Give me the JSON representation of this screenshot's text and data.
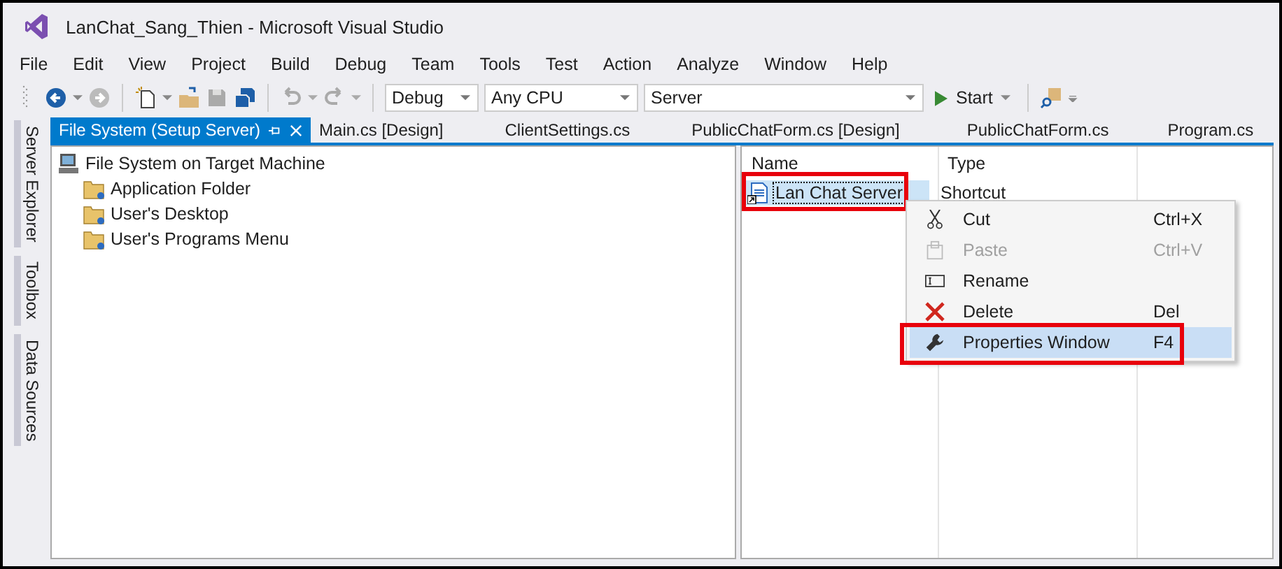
{
  "window": {
    "title": "LanChat_Sang_Thien - Microsoft Visual Studio"
  },
  "menu": [
    "File",
    "Edit",
    "View",
    "Project",
    "Build",
    "Debug",
    "Team",
    "Tools",
    "Test",
    "Action",
    "Analyze",
    "Window",
    "Help"
  ],
  "toolbar": {
    "configuration": "Debug",
    "platform": "Any CPU",
    "project": "Server",
    "start": "Start"
  },
  "side_tabs": [
    "Server Explorer",
    "Toolbox",
    "Data Sources"
  ],
  "tabs": [
    {
      "label": "File System (Setup Server)",
      "selected": true
    },
    {
      "label": "Main.cs [Design]",
      "selected": false
    },
    {
      "label": "ClientSettings.cs",
      "selected": false
    },
    {
      "label": "PublicChatForm.cs [Design]",
      "selected": false
    },
    {
      "label": "PublicChatForm.cs",
      "selected": false
    },
    {
      "label": "Program.cs",
      "selected": false
    }
  ],
  "tree": [
    {
      "label": "File System on Target Machine",
      "children": [
        {
          "label": "Application Folder"
        },
        {
          "label": "User's Desktop"
        },
        {
          "label": "User's Programs Menu"
        }
      ]
    }
  ],
  "file_list": {
    "columns": [
      "Name",
      "Type"
    ],
    "rows": [
      {
        "name": "Lan Chat Server",
        "type": "Shortcut",
        "selected": true,
        "highlighted": true
      }
    ]
  },
  "context_menu": [
    {
      "kind": "cut",
      "label": "Cut",
      "shortcut": "Ctrl+X",
      "disabled": false,
      "selected": false,
      "highlighted": false
    },
    {
      "kind": "paste",
      "label": "Paste",
      "shortcut": "Ctrl+V",
      "disabled": true,
      "selected": false,
      "highlighted": false
    },
    {
      "kind": "rename",
      "label": "Rename",
      "disabled": false,
      "selected": false,
      "highlighted": false
    },
    {
      "kind": "delete",
      "label": "Delete",
      "shortcut": "Del",
      "disabled": false,
      "selected": false,
      "highlighted": false
    },
    {
      "kind": "properties",
      "label": "Properties Window",
      "shortcut": "F4",
      "disabled": false,
      "selected": true,
      "highlighted": true
    }
  ]
}
